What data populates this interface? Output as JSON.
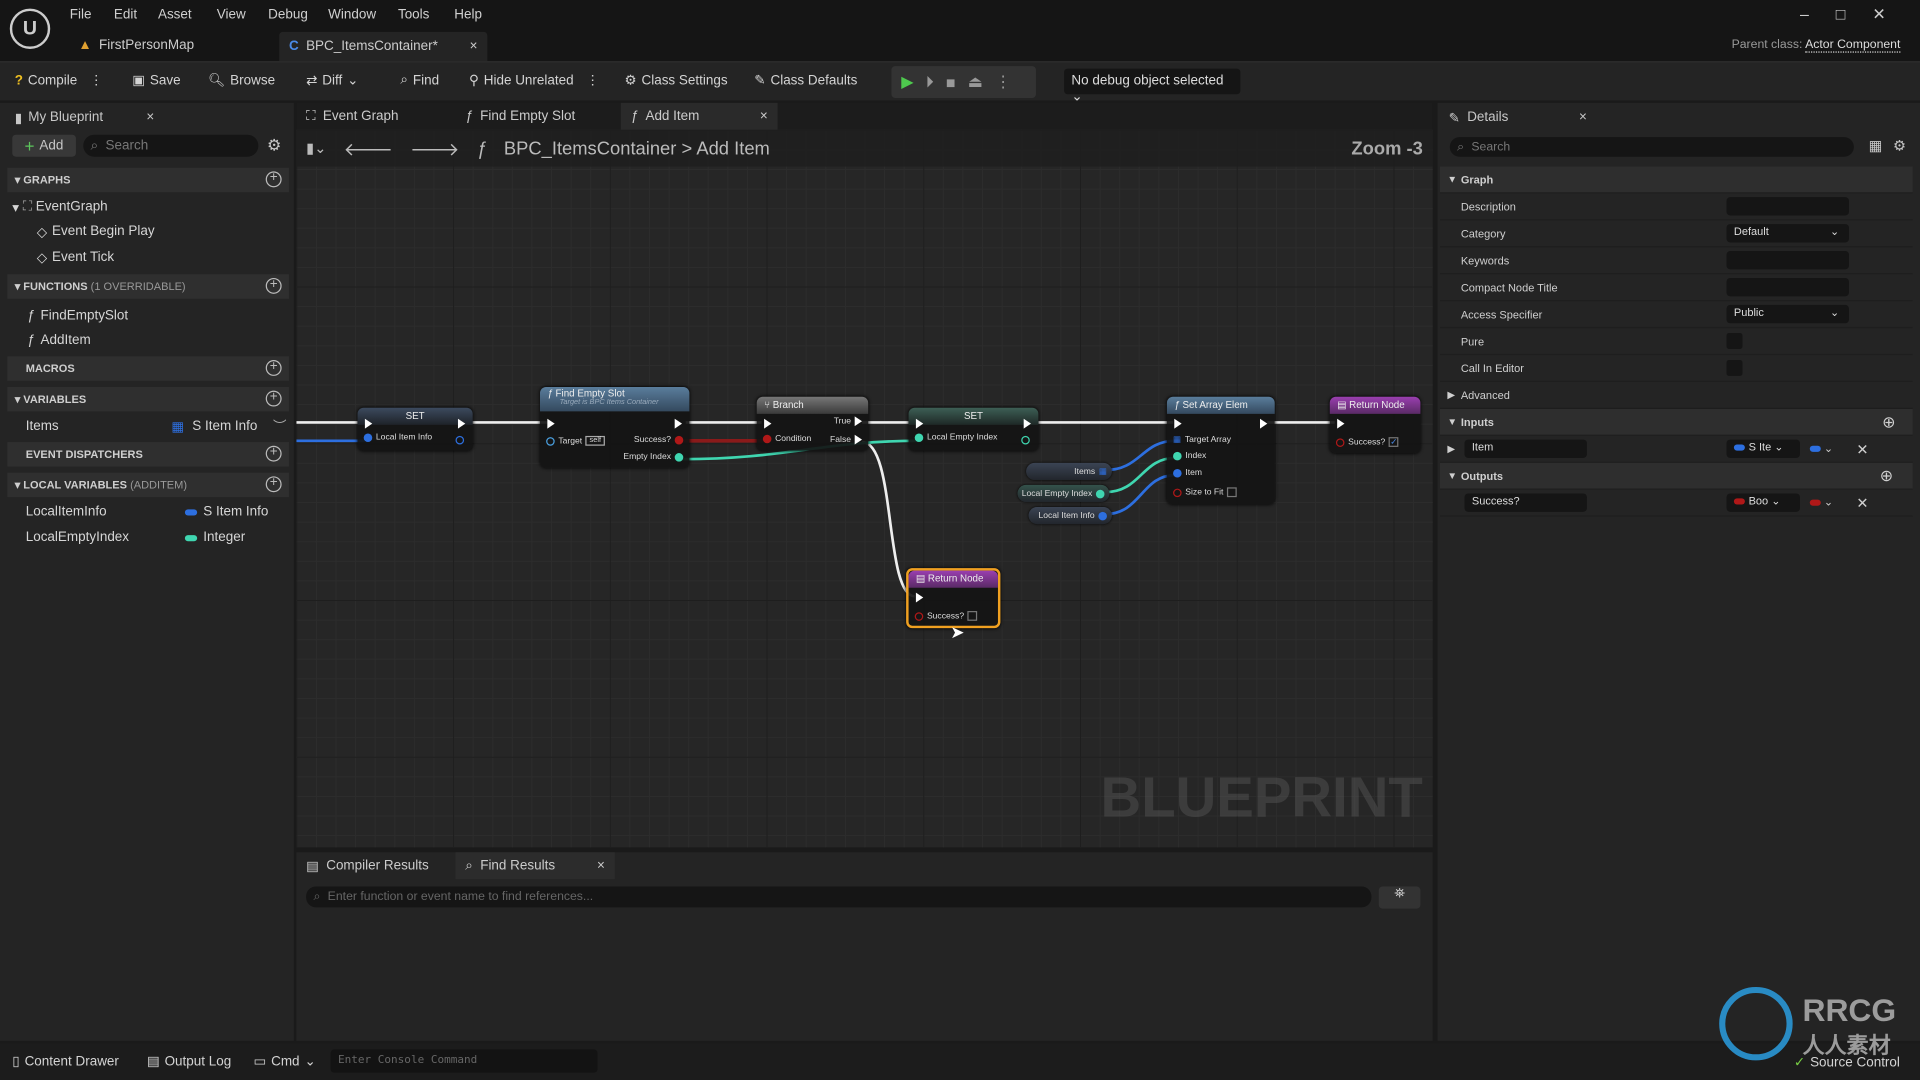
{
  "menu": [
    "File",
    "Edit",
    "Asset",
    "View",
    "Debug",
    "Window",
    "Tools",
    "Help"
  ],
  "doc_tabs": [
    {
      "label": "FirstPersonMap"
    },
    {
      "label": "BPC_ItemsContainer*",
      "close": "×"
    }
  ],
  "parent_class": {
    "label": "Parent class:",
    "value": "Actor Component"
  },
  "toolbar": {
    "compile": "Compile",
    "save": "Save",
    "browse": "Browse",
    "diff": "Diff",
    "find": "Find",
    "hide_unrelated": "Hide Unrelated",
    "class_settings": "Class Settings",
    "class_defaults": "Class Defaults",
    "debug_select": "No debug object selected"
  },
  "my_blueprint": {
    "tab": "My Blueprint",
    "add": "Add",
    "search_placeholder": "Search",
    "sections": {
      "graphs": "GRAPHS",
      "functions": "FUNCTIONS",
      "functions_note": "(1 OVERRIDABLE)",
      "macros": "MACROS",
      "variables": "VARIABLES",
      "dispatchers": "EVENT DISPATCHERS",
      "local_vars": "LOCAL VARIABLES",
      "local_note": "(ADDITEM)"
    },
    "graphs": [
      "EventGraph",
      "Event Begin Play",
      "Event Tick"
    ],
    "functions": [
      "FindEmptySlot",
      "AddItem"
    ],
    "variables": [
      {
        "name": "Items",
        "type": "S Item Info"
      }
    ],
    "local_variables": [
      {
        "name": "LocalItemInfo",
        "type": "S Item Info",
        "color": "#2d6fe0"
      },
      {
        "name": "LocalEmptyIndex",
        "type": "Integer",
        "color": "#3fd6b0"
      }
    ]
  },
  "graph_tabs": [
    "Event Graph",
    "Find Empty Slot",
    "Add Item"
  ],
  "breadcrumb": {
    "blueprint": "BPC_ItemsContainer",
    "function": "Add Item",
    "separator": ">"
  },
  "zoom": "Zoom -3",
  "watermark": "BLUEPRINT",
  "nodes": {
    "set1": {
      "title": "SET",
      "pin": "Local Item Info"
    },
    "find": {
      "title": "Find Empty Slot",
      "subtitle": "Target is BPC Items Container",
      "target": "Target",
      "self": "self",
      "success": "Success?",
      "empty_index": "Empty Index"
    },
    "branch": {
      "title": "Branch",
      "true": "True",
      "false": "False",
      "condition": "Condition"
    },
    "set2": {
      "title": "SET",
      "pin": "Local Empty Index"
    },
    "setarr": {
      "title": "Set Array Elem",
      "target": "Target Array",
      "index": "Index",
      "item": "Item",
      "size": "Size to Fit"
    },
    "ret1": {
      "title": "Return Node",
      "success": "Success?"
    },
    "ret2": {
      "title": "Return Node",
      "success": "Success?"
    },
    "get_items": "Items",
    "get_index": "Local Empty Index",
    "get_info": "Local Item Info"
  },
  "bottom": {
    "compiler_tab": "Compiler Results",
    "find_tab": "Find Results",
    "find_placeholder": "Enter function or event name to find references..."
  },
  "details": {
    "tab": "Details",
    "search_placeholder": "Search",
    "graph": "Graph",
    "description": "Description",
    "category": "Category",
    "category_value": "Default",
    "keywords": "Keywords",
    "compact": "Compact Node Title",
    "access": "Access Specifier",
    "access_value": "Public",
    "pure": "Pure",
    "call_in_editor": "Call In Editor",
    "advanced": "Advanced",
    "inputs": "Inputs",
    "input_name": "Item",
    "input_type": "S Ite",
    "outputs": "Outputs",
    "output_name": "Success?",
    "output_type": "Boo"
  },
  "statusbar": {
    "content_drawer": "Content Drawer",
    "output_log": "Output Log",
    "cmd": "Cmd",
    "console_placeholder": "Enter Console Command",
    "source_control": "Source Control"
  },
  "logo_watermark": "RRCG 人人素材",
  "colors": {
    "struct": "#2d6fe0",
    "integer": "#3fd6b0",
    "bool": "#b01818",
    "select": "#f0a020"
  }
}
